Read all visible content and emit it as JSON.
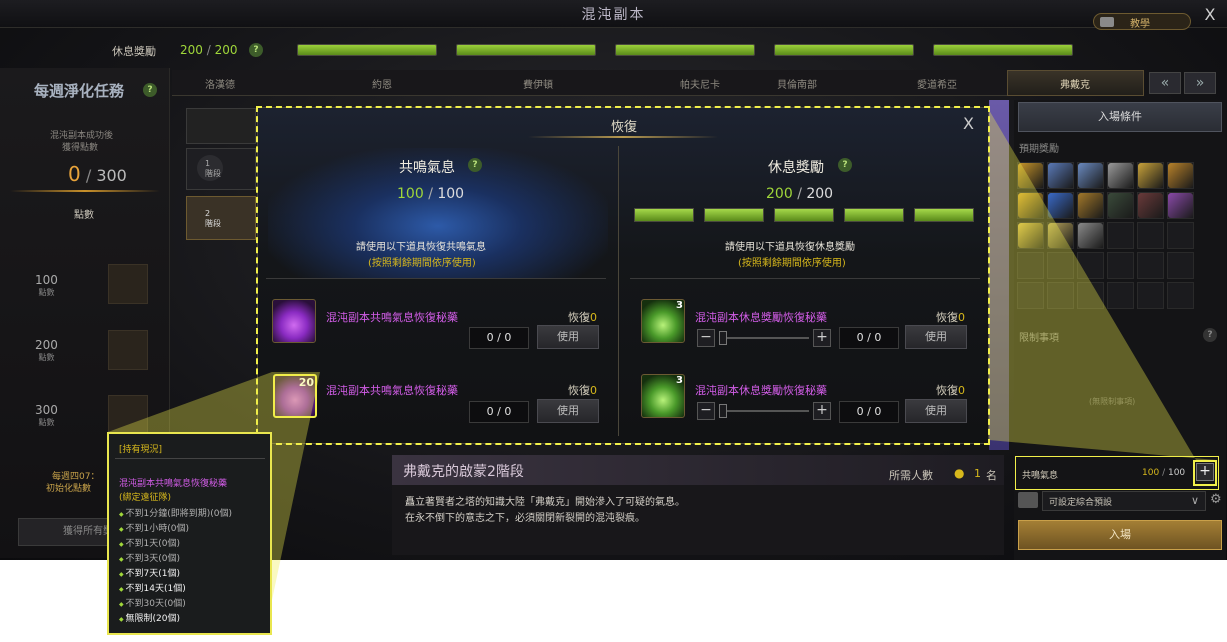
{
  "window": {
    "title": "混沌副本",
    "tutorial_label": "教學",
    "close_glyph": "X"
  },
  "rest_bar": {
    "label": "休息獎勵",
    "current": "200",
    "max": "200",
    "separator": "/",
    "help": "?"
  },
  "weekly": {
    "title": "每週淨化任務",
    "help": "?",
    "desc_line1": "混沌副本成功後",
    "desc_line2": "獲得點數",
    "points_current": "0",
    "points_max": "300",
    "separator": "/",
    "points_label": "點數",
    "rewards": [
      {
        "value": "100",
        "unit": "點數"
      },
      {
        "value": "200",
        "unit": "點數"
      },
      {
        "value": "300",
        "unit": "點數"
      }
    ],
    "reset_line1": "每週四07：",
    "reset_line2": "初始化點數",
    "claim_button": "獲得所有獎"
  },
  "tabs": [
    {
      "label": "洛漢德",
      "active": false
    },
    {
      "label": "約恩",
      "active": false
    },
    {
      "label": "費伊頓",
      "active": false
    },
    {
      "label": "帕夫尼卡",
      "active": false
    },
    {
      "label": "貝倫南部",
      "active": false
    },
    {
      "label": "愛道希亞",
      "active": false
    },
    {
      "label": "弗戴克",
      "active": true
    }
  ],
  "stages": [
    {
      "label": "1\n階段"
    },
    {
      "label": "2\n階段"
    }
  ],
  "right": {
    "entry_conditions": "入場條件",
    "expected_rewards": "預期獎勵",
    "restrictions": "限制事項",
    "restrictions_help": "?",
    "no_restrictions": "(無限制事項)",
    "resonance_label": "共鳴氣息",
    "resonance_current": "100",
    "resonance_max": "100",
    "separator": "/",
    "plus": "+",
    "preset_label": "可設定綜合預設",
    "enter_button": "入場"
  },
  "stage_info": {
    "title": "弗戴克的啟蒙2階段",
    "required_label": "所需人數",
    "required_value": "1",
    "required_unit": "名",
    "desc_line1": "矗立著賢者之塔的知識大陸「弗戴克」開始滲入了可疑的氣息。",
    "desc_line2": "在永不倒下的意志之下，必須關閉新裂開的混沌裂痕。"
  },
  "modal": {
    "title": "恢復",
    "close": "X",
    "left": {
      "title": "共鳴氣息",
      "help": "?",
      "current": "100",
      "max": "100",
      "separator": "/",
      "instr": "請使用以下道具恢復共鳴氣息",
      "note": "(按照剩餘期間依序使用)",
      "rows": [
        {
          "name": "混沌副本共鳴氣息恢復秘藥",
          "recover_label": "恢復",
          "recover_value": "0",
          "count": "0 / 0",
          "use": "使用",
          "badge": ""
        },
        {
          "name": "混沌副本共鳴氣息恢復秘藥",
          "recover_label": "恢復",
          "recover_value": "0",
          "count": "0 / 0",
          "use": "使用",
          "badge": "20"
        }
      ]
    },
    "right": {
      "title": "休息獎勵",
      "help": "?",
      "current": "200",
      "max": "200",
      "separator": "/",
      "instr": "請使用以下道具恢復休息獎勵",
      "note": "(按照剩餘期間依序使用)",
      "rows": [
        {
          "name": "混沌副本休息獎勵恢復秘藥",
          "recover_label": "恢復",
          "recover_value": "0",
          "count": "0 / 0",
          "use": "使用",
          "badge": "3",
          "minus": "−",
          "plus": "+"
        },
        {
          "name": "混沌副本休息獎勵恢復秘藥",
          "recover_label": "恢復",
          "recover_value": "0",
          "count": "0 / 0",
          "use": "使用",
          "badge": "3",
          "minus": "−",
          "plus": "+"
        }
      ]
    }
  },
  "tooltip": {
    "header": "[持有現況]",
    "item_name": "混沌副本共鳴氣息恢復秘藥",
    "bound": "(綁定遠征隊)",
    "lines": [
      {
        "text": "不到1分鐘(即將到期)(0個)",
        "bright": false
      },
      {
        "text": "不到1小時(0個)",
        "bright": false
      },
      {
        "text": "不到1天(0個)",
        "bright": false
      },
      {
        "text": "不到3天(0個)",
        "bright": false
      },
      {
        "text": "不到7天(1個)",
        "bright": true
      },
      {
        "text": "不到14天(1個)",
        "bright": true
      },
      {
        "text": "不到30天(0個)",
        "bright": false
      },
      {
        "text": "無限制(20個)",
        "bright": true
      }
    ]
  },
  "colors": {
    "accent_gold": "#d7b81c",
    "green_value": "#9fd63a",
    "purple_item": "#d35de8",
    "highlight_yellow": "#f1ef4a"
  }
}
